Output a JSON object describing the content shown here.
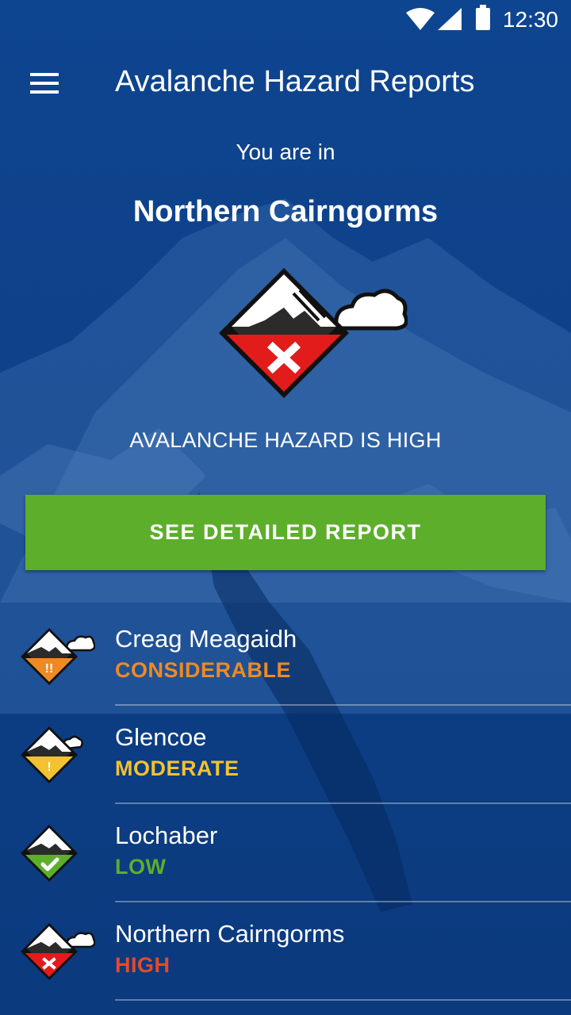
{
  "status_bar": {
    "time": "12:30"
  },
  "app_bar": {
    "title": "Avalanche Hazard Reports",
    "menu_icon": "hamburger-menu-icon"
  },
  "current": {
    "prefix": "You are in",
    "location": "Northern Cairngorms",
    "hazard_text": "AVALANCHE HAZARD IS HIGH",
    "icon": "avalanche-high-icon"
  },
  "report_button": {
    "label": "SEE DETAILED REPORT",
    "color": "#5dae2b"
  },
  "regions": [
    {
      "name": "Creag Meagaidh",
      "level": "CONSIDERABLE",
      "color": "#ee8a24",
      "icon": "avalanche-considerable-icon",
      "symbol": "!!"
    },
    {
      "name": "Glencoe",
      "level": "MODERATE",
      "color": "#f2c230",
      "icon": "avalanche-moderate-icon",
      "symbol": "!"
    },
    {
      "name": "Lochaber",
      "level": "LOW",
      "color": "#5dae2b",
      "icon": "avalanche-low-icon",
      "symbol": "check"
    },
    {
      "name": "Northern Cairngorms",
      "level": "HIGH",
      "color": "#e64a2a",
      "icon": "avalanche-high-icon",
      "symbol": "x"
    }
  ],
  "colors": {
    "background": "#0d3f86",
    "high": "#e21b1b"
  }
}
